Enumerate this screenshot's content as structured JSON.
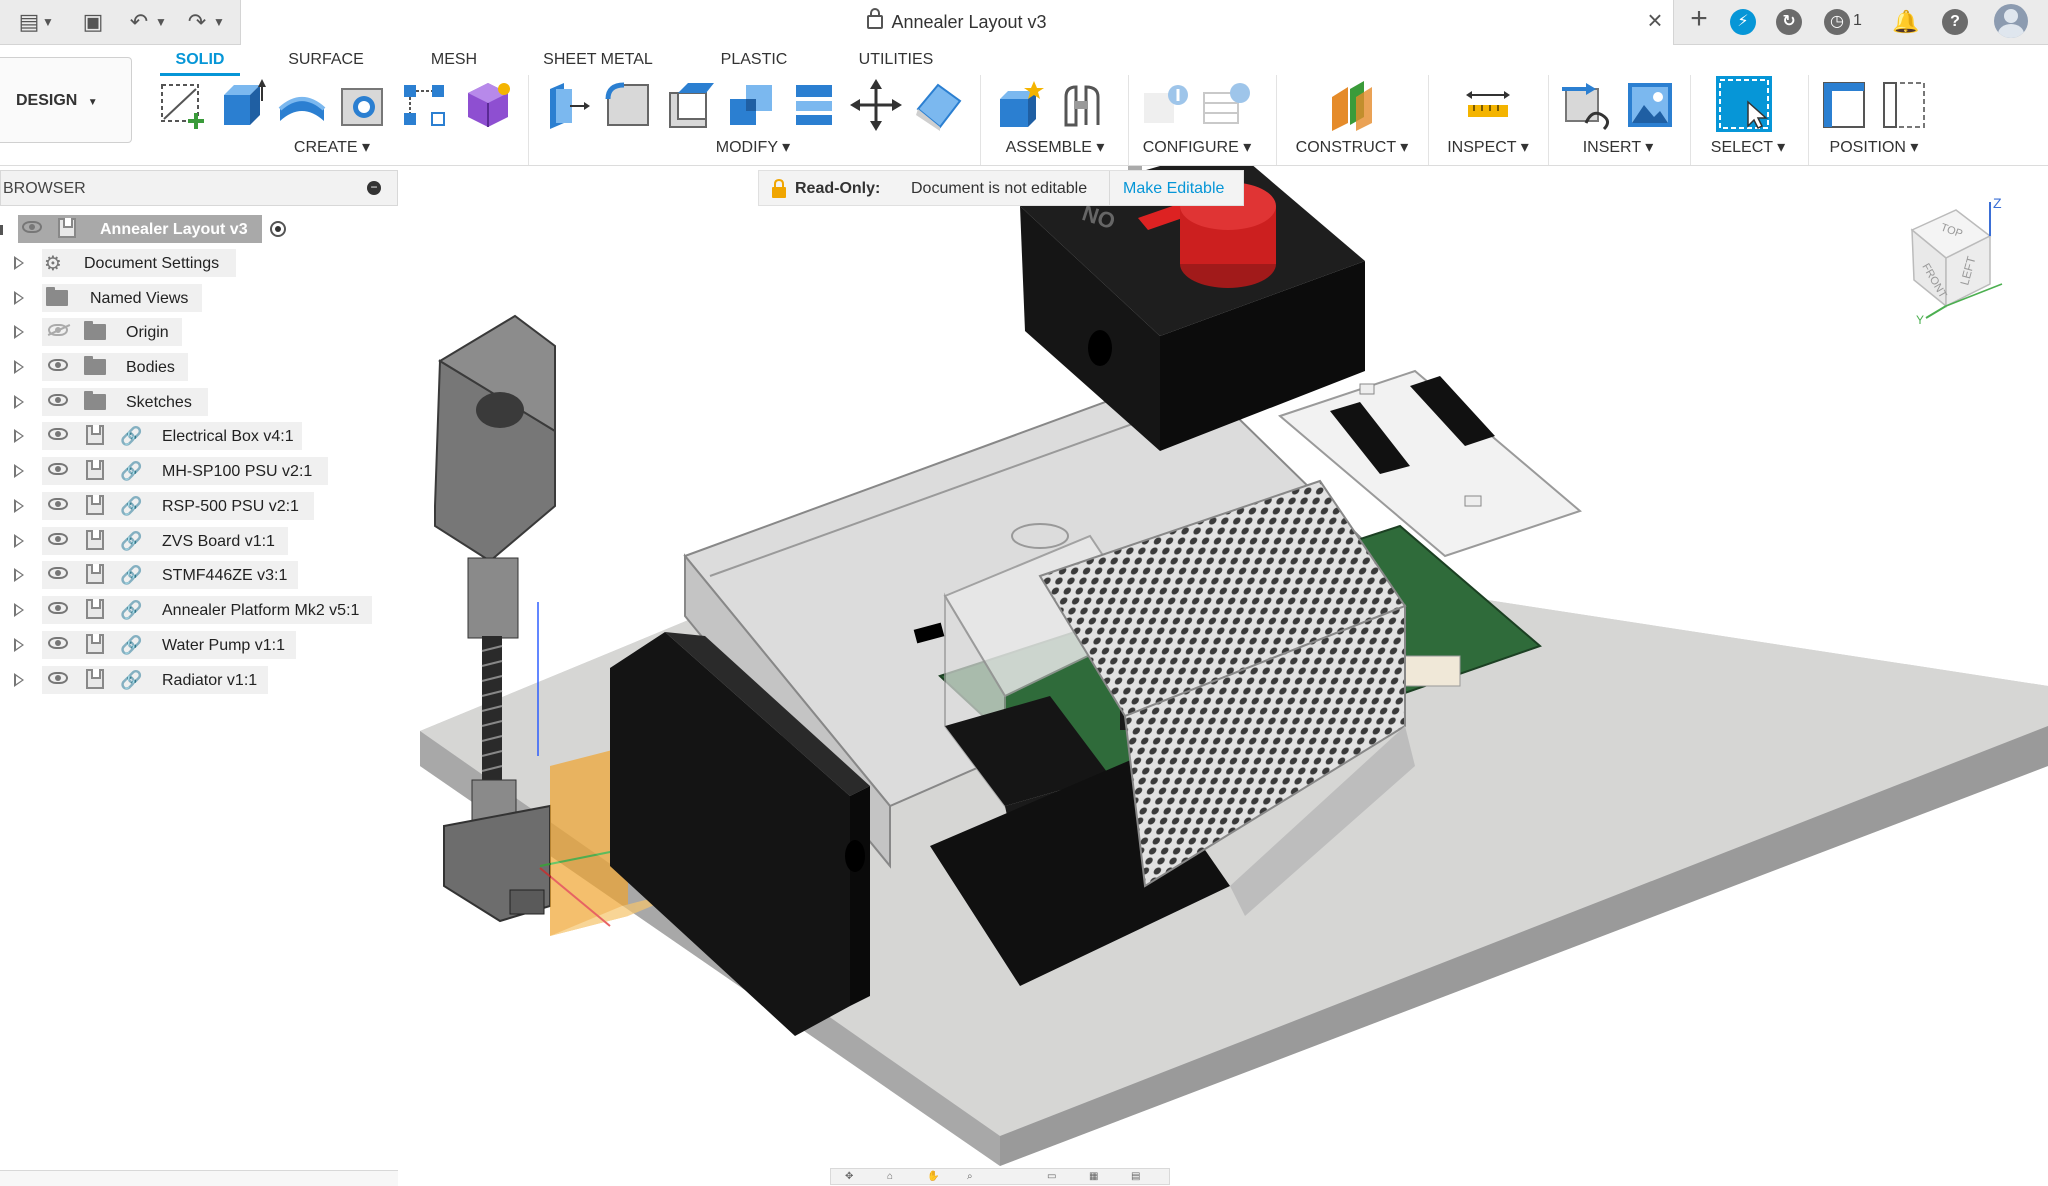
{
  "title_bar": {
    "document_title": "Annealer Layout v3",
    "close_symbol": "×",
    "add_tab_symbol": "+",
    "job_status_count": "1"
  },
  "workspace": {
    "label": "DESIGN"
  },
  "tabs": [
    {
      "label": "SOLID",
      "active": true
    },
    {
      "label": "SURFACE",
      "active": false
    },
    {
      "label": "MESH",
      "active": false
    },
    {
      "label": "SHEET METAL",
      "active": false
    },
    {
      "label": "PLASTIC",
      "active": false
    },
    {
      "label": "UTILITIES",
      "active": false
    }
  ],
  "groups": [
    {
      "label": "CREATE"
    },
    {
      "label": "MODIFY"
    },
    {
      "label": "ASSEMBLE"
    },
    {
      "label": "CONFIGURE"
    },
    {
      "label": "CONSTRUCT"
    },
    {
      "label": "INSPECT"
    },
    {
      "label": "INSERT"
    },
    {
      "label": "SELECT"
    },
    {
      "label": "POSITION"
    }
  ],
  "browser": {
    "title": "BROWSER",
    "collapse_symbol": "−",
    "root": "Annealer Layout v3",
    "items": [
      {
        "label": "Document Settings",
        "icon": "gear-icon"
      },
      {
        "label": "Named Views",
        "icon": "folder-icon"
      },
      {
        "label": "Origin",
        "icon": "folder-icon",
        "hidden": true
      },
      {
        "label": "Bodies",
        "icon": "folder-icon"
      },
      {
        "label": "Sketches",
        "icon": "folder-icon"
      },
      {
        "label": "Electrical Box v4:1",
        "icon": "component-icon"
      },
      {
        "label": "MH-SP100 PSU v2:1",
        "icon": "component-icon"
      },
      {
        "label": "RSP-500 PSU v2:1",
        "icon": "component-icon"
      },
      {
        "label": "ZVS Board v1:1",
        "icon": "component-icon"
      },
      {
        "label": "STMF446ZE v3:1",
        "icon": "component-icon"
      },
      {
        "label": "Annealer Platform Mk2 v5:1",
        "icon": "component-icon"
      },
      {
        "label": "Water Pump v1:1",
        "icon": "component-icon"
      },
      {
        "label": "Radiator v1:1",
        "icon": "component-icon"
      }
    ]
  },
  "banner": {
    "label": "Read-Only:",
    "message": "Document is not editable",
    "action": "Make Editable"
  },
  "viewcube": {
    "top": "TOP",
    "left": "LEFT",
    "front": "FRONT",
    "axis_z": "Z",
    "axis_y": "Y"
  },
  "model_labels": {
    "switch_on": "ON"
  },
  "colors": {
    "accent": "#0696d7",
    "estop": "#cc1f1f",
    "pcb": "#2f6b3a",
    "plate": "#c9c9c9",
    "box": "#1c1c1c"
  }
}
